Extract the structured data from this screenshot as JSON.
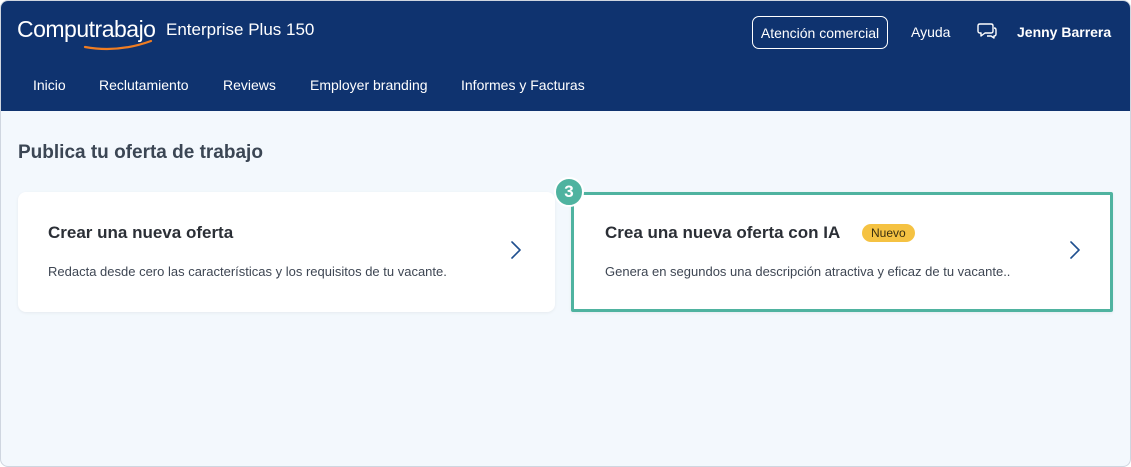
{
  "header": {
    "logo_text": "Computrabajo",
    "plan_label": "Enterprise Plus 150",
    "commercial_button": "Atención comercial",
    "help_link": "Ayuda",
    "user_name": "Jenny Barrera",
    "background_color": "#0f336f"
  },
  "nav": {
    "items": [
      {
        "label": "Inicio"
      },
      {
        "label": "Reclutamiento"
      },
      {
        "label": "Reviews"
      },
      {
        "label": "Employer branding"
      },
      {
        "label": "Informes y Facturas"
      }
    ]
  },
  "main": {
    "title": "Publica tu oferta de trabajo",
    "cards": [
      {
        "title": "Crear una nueva oferta",
        "description": "Redacta desde cero las características y los requisitos de tu vacante."
      },
      {
        "title": "Crea una nueva oferta con IA",
        "badge": "Nuevo",
        "description": "Genera en segundos una descripción atractiva y eficaz de tu vacante..",
        "highlight_color": "#4fb3a0"
      }
    ],
    "step_marker": "3"
  },
  "colors": {
    "accent_teal": "#4fb3a0",
    "badge_yellow": "#f5c242",
    "logo_swoosh": "#f07d22",
    "page_background": "#f3f8fd"
  }
}
